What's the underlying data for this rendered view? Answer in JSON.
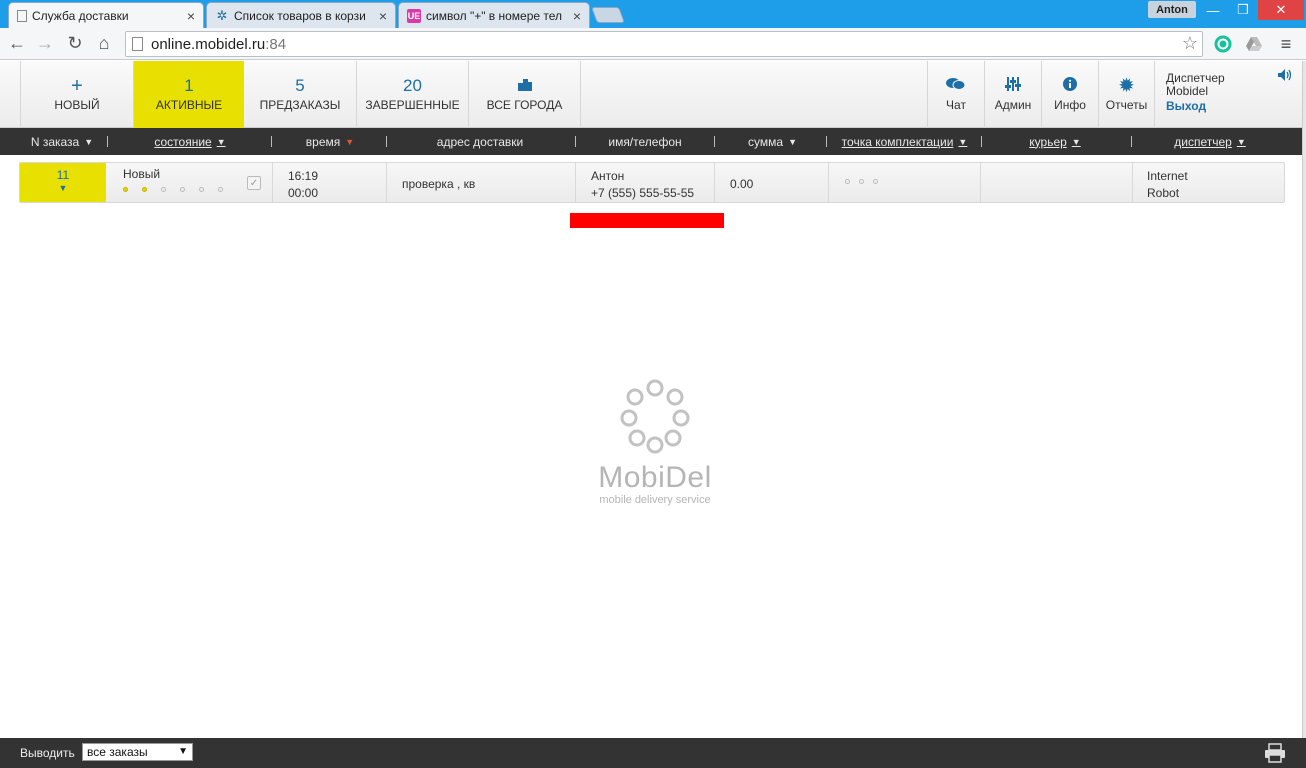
{
  "browser": {
    "tabs": [
      {
        "label": "Служба доставки",
        "active": true
      },
      {
        "label": "Список товаров в корзи",
        "active": false
      },
      {
        "label": "символ \"+\" в номере тел",
        "active": false
      }
    ],
    "profile": "Anton",
    "url_host": "online.mobidel.ru",
    "url_port": ":84",
    "fav3_text": "UE"
  },
  "nav": {
    "new": {
      "icon": "+",
      "label": "НОВЫЙ"
    },
    "active": {
      "num": "1",
      "label": "АКТИВНЫЕ"
    },
    "preorders": {
      "num": "5",
      "label": "ПРЕДЗАКАЗЫ"
    },
    "completed": {
      "num": "20",
      "label": "ЗАВЕРШЕННЫЕ"
    },
    "cities": {
      "label": "ВСЕ ГОРОДА"
    }
  },
  "right_menu": {
    "chat": "Чат",
    "admin": "Админ",
    "info": "Инфо",
    "reports": "Отчеты",
    "dispatcher_line1": "Диспетчер",
    "dispatcher_line2": "Mobidel",
    "exit": "Выход"
  },
  "columns": {
    "order_num": "N заказа",
    "state": "состояние",
    "time": "время",
    "address": "адрес доставки",
    "name_phone": "имя/телефон",
    "sum": "сумма",
    "pickup_point": "точка комплектации",
    "courier": "курьер",
    "dispatcher": "диспетчер"
  },
  "order": {
    "number": "11",
    "state": "Новый",
    "progress_steps_done": 2,
    "progress_steps_total": 6,
    "time_line1": "16:19",
    "time_line2": "00:00",
    "address": "проверка , кв",
    "name": "Антон",
    "phone": "+7 (555) 555-55-55",
    "sum": "0.00",
    "dispatcher_line1": "Internet",
    "dispatcher_line2": "Robot"
  },
  "logo": {
    "brand": "MobiDel",
    "tagline": "mobile delivery service"
  },
  "footer": {
    "label": "Выводить",
    "filter_value": "все заказы"
  },
  "colors": {
    "accent_yellow": "#e8e000",
    "accent_blue": "#1d6fa5",
    "dark_bar": "#333333",
    "redaction": "#ff0000"
  }
}
